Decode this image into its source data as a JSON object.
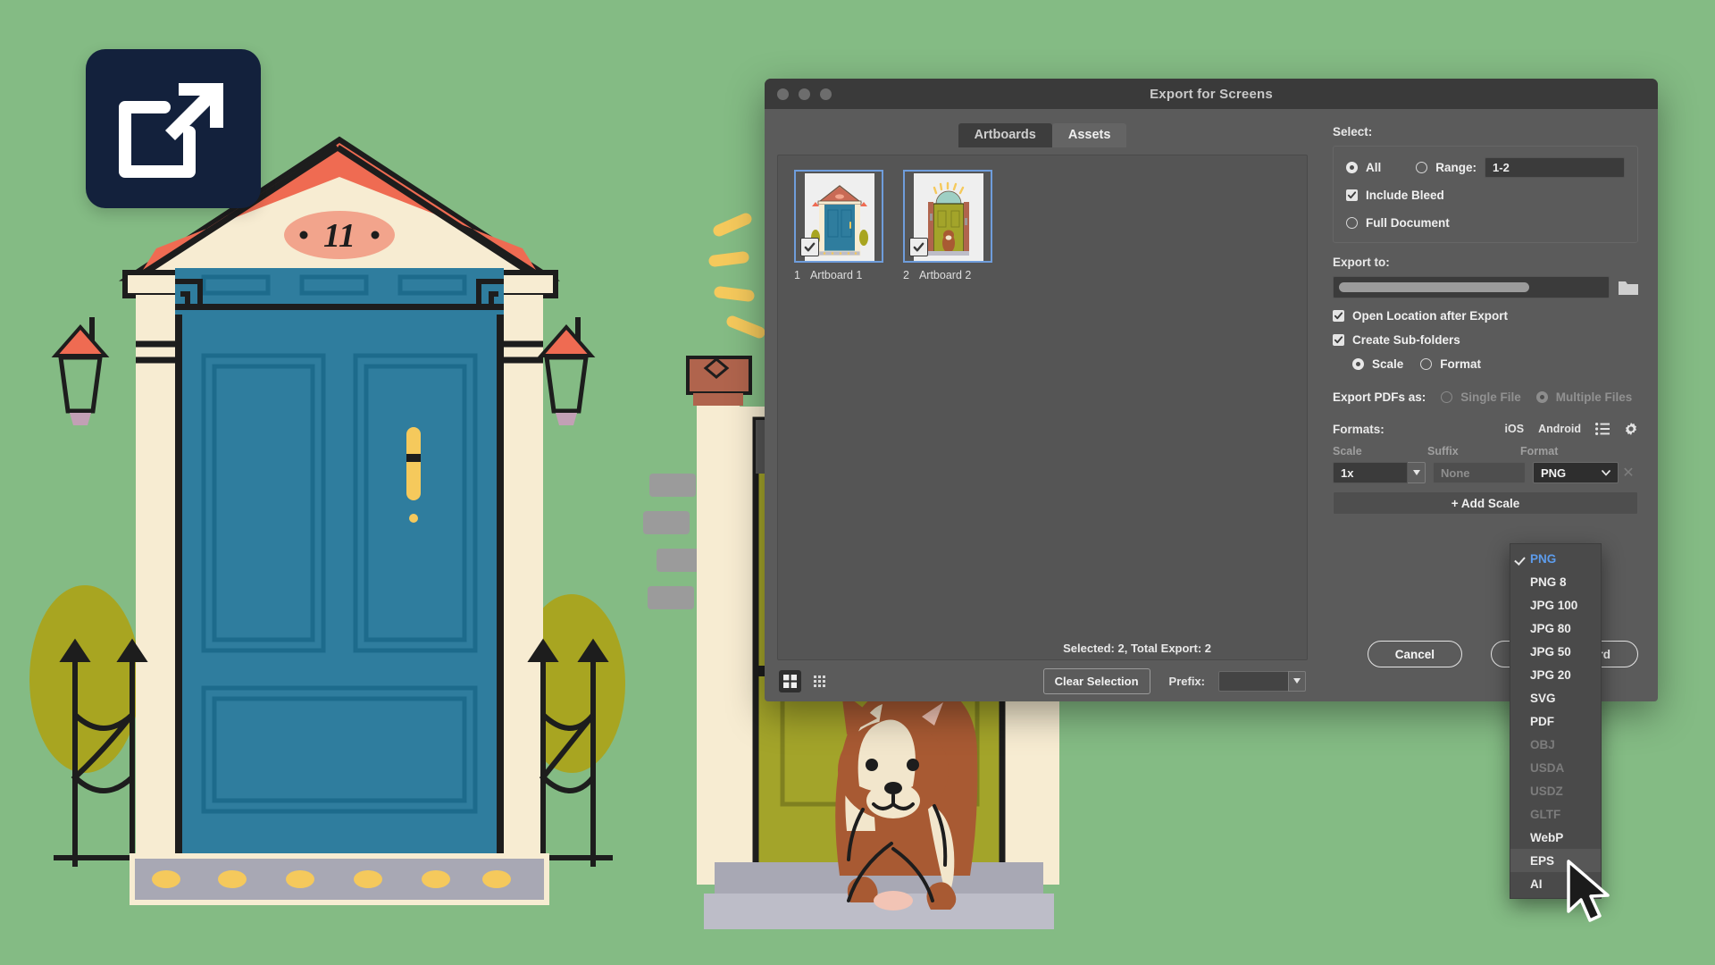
{
  "background": {
    "name": "front-door-illustration",
    "canvas_color": "#84bb84",
    "badge_icon": "external-link-export-icon",
    "badge_color": "#13213c",
    "house_number": "11",
    "door1_color": "#2f7d9e",
    "door2_color": "#a3a42a",
    "trim_color": "#f7ecd2",
    "roof_color": "#ef6b52",
    "dog": "french-bulldog"
  },
  "dialog": {
    "title": "Export for Screens",
    "tabs": [
      {
        "label": "Artboards",
        "active": true
      },
      {
        "label": "Assets",
        "active": false
      }
    ],
    "artboards": [
      {
        "index": "1",
        "name": "Artboard 1",
        "checked": true
      },
      {
        "index": "2",
        "name": "Artboard 2",
        "checked": true
      }
    ],
    "view_modes": [
      {
        "name": "grid-view",
        "active": true
      },
      {
        "name": "list-view",
        "active": false
      }
    ],
    "clear_selection_label": "Clear Selection",
    "prefix_label": "Prefix:",
    "prefix_value": "",
    "status": "Selected: 2, Total Export: 2",
    "cancel_label": "Cancel",
    "primary_label": "Export Artboard"
  },
  "select_section": {
    "heading": "Select:",
    "all_label": "All",
    "all_selected": true,
    "range_label": "Range:",
    "range_selected": false,
    "range_value": "1-2",
    "include_bleed_label": "Include Bleed",
    "include_bleed_checked": true,
    "full_document_label": "Full Document",
    "full_document_selected": false
  },
  "export_to": {
    "heading": "Export to:",
    "path_value": "",
    "folder_icon": "folder-icon",
    "open_location_label": "Open Location after Export",
    "open_location_checked": true,
    "create_subfolders_label": "Create Sub-folders",
    "create_subfolders_checked": true,
    "subfolder_by": [
      {
        "label": "Scale",
        "selected": true
      },
      {
        "label": "Format",
        "selected": false
      }
    ]
  },
  "pdf_section": {
    "label": "Export PDFs as:",
    "disabled": true,
    "options": [
      {
        "label": "Single File",
        "selected": false
      },
      {
        "label": "Multiple Files",
        "selected": true
      }
    ]
  },
  "formats": {
    "heading": "Formats:",
    "preset_ios": "iOS",
    "preset_android": "Android",
    "list_icon": "list-icon",
    "gear_icon": "gear-icon",
    "columns": {
      "scale": "Scale",
      "suffix": "Suffix",
      "format": "Format"
    },
    "rows": [
      {
        "scale": "1x",
        "suffix_placeholder": "None",
        "suffix_value": "",
        "format": "PNG"
      }
    ],
    "add_scale_label": "+ Add Scale",
    "remove_icon": "close-icon"
  },
  "format_menu": {
    "open": true,
    "selected": "PNG",
    "hovered": "EPS",
    "items": [
      {
        "label": "PNG",
        "disabled": false,
        "checked": true
      },
      {
        "label": "PNG 8",
        "disabled": false,
        "checked": false
      },
      {
        "label": "JPG 100",
        "disabled": false,
        "checked": false
      },
      {
        "label": "JPG 80",
        "disabled": false,
        "checked": false
      },
      {
        "label": "JPG 50",
        "disabled": false,
        "checked": false
      },
      {
        "label": "JPG 20",
        "disabled": false,
        "checked": false
      },
      {
        "label": "SVG",
        "disabled": false,
        "checked": false
      },
      {
        "label": "PDF",
        "disabled": false,
        "checked": false
      },
      {
        "label": "OBJ",
        "disabled": true,
        "checked": false
      },
      {
        "label": "USDA",
        "disabled": true,
        "checked": false
      },
      {
        "label": "USDZ",
        "disabled": true,
        "checked": false
      },
      {
        "label": "GLTF",
        "disabled": true,
        "checked": false
      },
      {
        "label": "WebP",
        "disabled": false,
        "checked": false
      },
      {
        "label": "EPS",
        "disabled": false,
        "checked": false
      },
      {
        "label": "AI",
        "disabled": false,
        "checked": false
      }
    ]
  }
}
